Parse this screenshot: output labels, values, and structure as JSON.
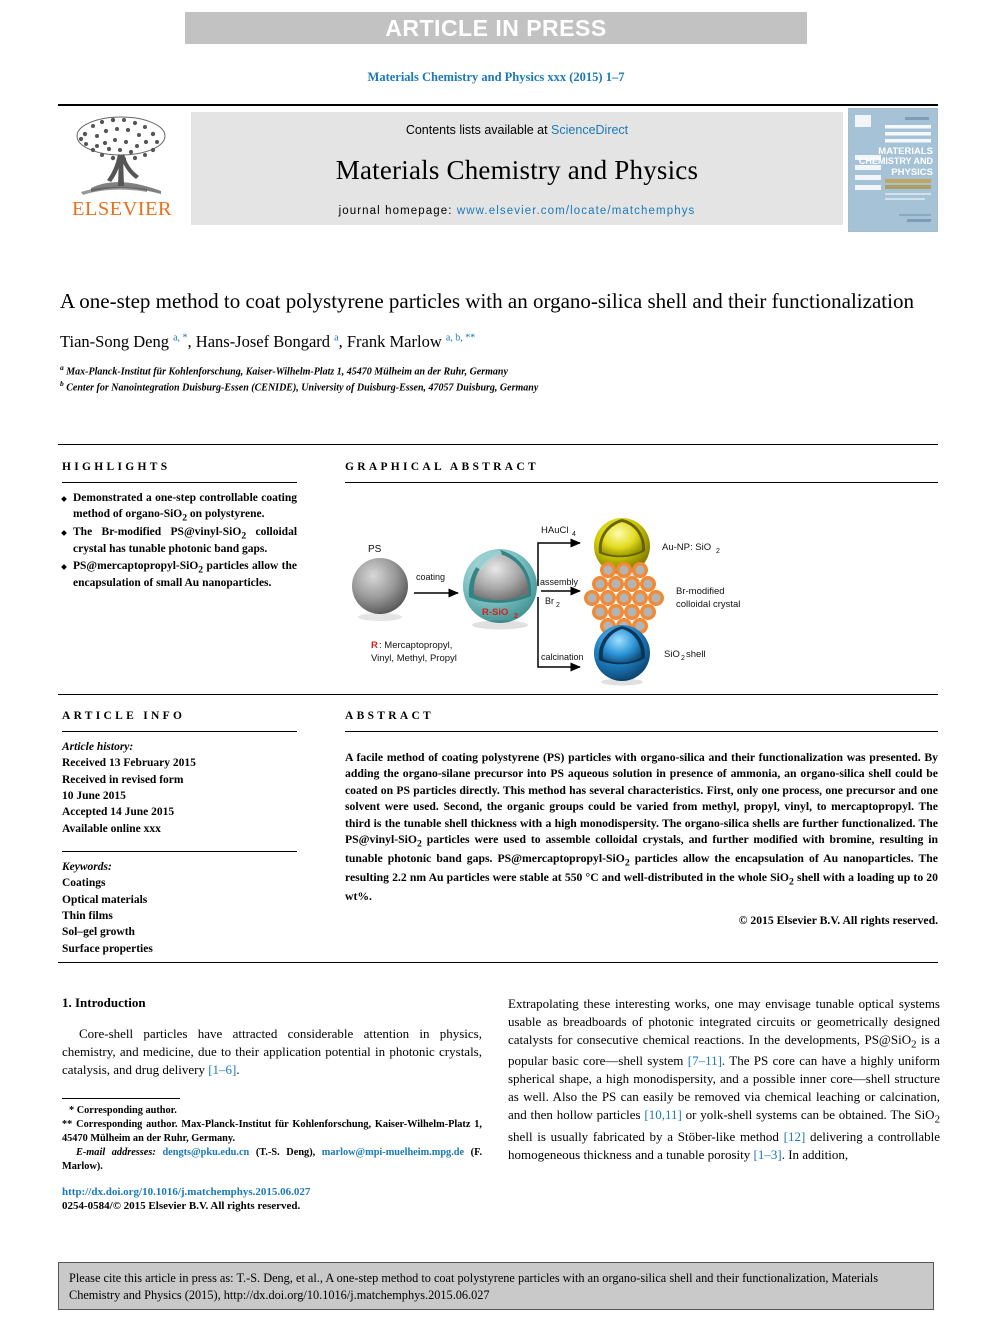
{
  "banner": {
    "text": "ARTICLE IN PRESS"
  },
  "running_head": {
    "text": "Materials Chemistry and Physics xxx (2015) 1–7"
  },
  "masthead": {
    "elsevier_word": "ELSEVIER",
    "contents_prefix": "Contents lists available at ",
    "contents_link": "ScienceDirect",
    "journal_name": "Materials Chemistry and Physics",
    "homepage_prefix": "journal homepage: ",
    "homepage_url": "www.elsevier.com/locate/matchemphys",
    "cover_title_1": "MATERIALS",
    "cover_title_2": "CHEMISTRY AND",
    "cover_title_3": "PHYSICS"
  },
  "article": {
    "title": "A one-step method to coat polystyrene particles with an organo-silica shell and their functionalization",
    "authors_html": "Tian-Song Deng <sup>a, *</sup>, Hans-Josef Bongard <sup>a</sup>, Frank Marlow <sup>a, b, **</sup>",
    "affiliation_a": "Max-Planck-Institut für Kohlenforschung, Kaiser-Wilhelm-Platz 1, 45470 Mülheim an der Ruhr, Germany",
    "affiliation_b": "Center for Nanointegration Duisburg-Essen (CENIDE), University of Duisburg-Essen, 47057 Duisburg, Germany"
  },
  "highlights": {
    "heading": "HIGHLIGHTS",
    "items": [
      "Demonstrated a one-step controllable coating method of organo-SiO2 on polystyrene.",
      "The Br-modified PS@vinyl-SiO2 colloidal crystal has tunable photonic band gaps.",
      "PS@mercaptopropyl-SiO2 particles allow the encapsulation of small Au nanoparticles."
    ]
  },
  "graphical_abstract": {
    "heading": "GRAPHICAL ABSTRACT",
    "labels": {
      "ps": "PS",
      "coating": "coating",
      "core_shell": "R-SiO2",
      "legend_r": "R",
      "legend_text_1": ": Mercaptopropyl,",
      "legend_text_2": "Vinyl, Methyl, Propyl",
      "branch_top_reagent": "HAuCl4",
      "branch_top_product": "Au-NP: SiO2",
      "branch_mid_reagent_1": "assembly",
      "branch_mid_reagent_2": "Br2",
      "branch_mid_product_1": "Br-modified",
      "branch_mid_product_2": "colloidal crystal",
      "branch_bot_reagent": "calcination",
      "branch_bot_product": "SiO2 shell"
    }
  },
  "article_info": {
    "heading": "ARTICLE INFO",
    "history_label": "Article history:",
    "history": [
      "Received 13 February 2015",
      "Received in revised form",
      "10 June 2015",
      "Accepted 14 June 2015",
      "Available online xxx"
    ],
    "keywords_label": "Keywords:",
    "keywords": [
      "Coatings",
      "Optical materials",
      "Thin films",
      "Sol–gel growth",
      "Surface properties"
    ]
  },
  "abstract": {
    "heading": "ABSTRACT",
    "text": "A facile method of coating polystyrene (PS) particles with organo-silica and their functionalization was presented. By adding the organo-silane precursor into PS aqueous solution in presence of ammonia, an organo-silica shell could be coated on PS particles directly. This method has several characteristics. First, only one process, one precursor and one solvent were used. Second, the organic groups could be varied from methyl, propyl, vinyl, to mercaptopropyl. The third is the tunable shell thickness with a high monodispersity. The organo-silica shells are further functionalized. The PS@vinyl-SiO2 particles were used to assemble colloidal crystals, and further modified with bromine, resulting in tunable photonic band gaps. PS@mercaptopropyl-SiO2 particles allow the encapsulation of Au nanoparticles. The resulting 2.2 nm Au particles were stable at 550 °C and well-distributed in the whole SiO2 shell with a loading up to 20 wt%.",
    "copyright": "© 2015 Elsevier B.V. All rights reserved."
  },
  "body": {
    "section_number_title": "1. Introduction",
    "left_paragraph_pre": "Core-shell particles have attracted considerable attention in physics, chemistry, and medicine, due to their application potential in photonic crystals, catalysis, and drug delivery ",
    "left_ref_1": "[1–6]",
    "left_paragraph_post": ".",
    "right_p1": "Extrapolating these interesting works, one may envisage tunable optical systems usable as breadboards of photonic integrated circuits or geometrically designed catalysts for consecutive chemical reactions. In the developments, PS@SiO2 is a popular basic core—shell system ",
    "right_ref_1": "[7–11]",
    "right_p2": ". The PS core can have a highly uniform spherical shape, a high monodispersity, and a possible inner core—shell structure as well. Also the PS can easily be removed via chemical leaching or calcination, and then hollow particles ",
    "right_ref_2": "[10,11]",
    "right_p3": " or yolk-shell systems can be obtained. The SiO2 shell is usually fabricated by a Stöber-like method ",
    "right_ref_3": "[12]",
    "right_p4": " delivering a controllable homogeneous thickness and a tunable porosity ",
    "right_ref_4": "[1–3]",
    "right_p5": ". In addition,"
  },
  "footnotes": {
    "line1": "* Corresponding author.",
    "line2": "** Corresponding author. Max-Planck-Institut für Kohlenforschung, Kaiser-Wilhelm-Platz 1, 45470 Mülheim an der Ruhr, Germany.",
    "email_label": "E-mail addresses:",
    "email1": "dengts@pku.edu.cn",
    "email1_owner": "(T.-S. Deng)",
    "email2": "marlow@mpi-muelheim.mpg.de",
    "email2_owner": "(F. Marlow).",
    "doi": "http://dx.doi.org/10.1016/j.matchemphys.2015.06.027",
    "issn": "0254-0584/© 2015 Elsevier B.V. All rights reserved."
  },
  "citation_footer": {
    "text": "Please cite this article in press as: T.-S. Deng, et al., A one-step method to coat polystyrene particles with an organo-silica shell and their functionalization, Materials Chemistry and Physics (2015), http://dx.doi.org/10.1016/j.matchemphys.2015.06.027"
  },
  "colors": {
    "link_blue": "#1b79b8",
    "elsevier_orange": "#e8711a",
    "banner_gray": "#c2c2c2",
    "band_gray": "#e4e4e4",
    "footer_gray": "#c9c9c9",
    "ga_teal": "#7fc0c0",
    "ga_gold": "#c8c400",
    "ga_blue": "#1f7fc4",
    "ga_orange": "#f08a35",
    "ga_red": "#e01b1b"
  }
}
